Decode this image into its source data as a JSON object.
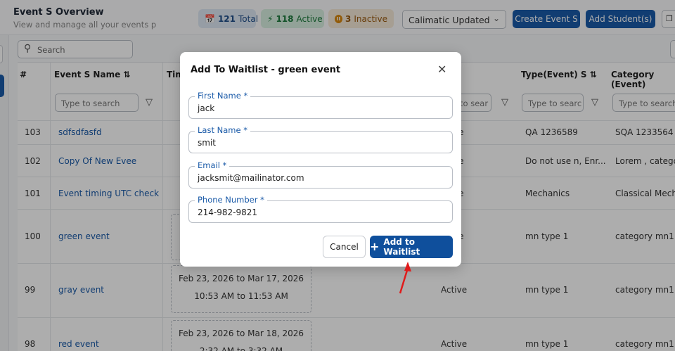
{
  "header": {
    "title": "Event S Overview",
    "subtitle": "View and manage all your events p",
    "stats": {
      "total_count": "121",
      "total_label": "Total",
      "active_count": "118",
      "active_label": "Active",
      "inactive_count": "3",
      "inactive_label": "Inactive"
    },
    "select_value": "Calimatic Updated",
    "create_button": "Create Event S",
    "add_students_button": "Add Student(s)"
  },
  "search": {
    "placeholder": "Search"
  },
  "table": {
    "headers": {
      "number": "#",
      "name": "Event S Name",
      "time": "Tim",
      "type": "Type(Event) S",
      "category": "Category (Event)"
    },
    "filter_placeholder": "Type to search",
    "filter_placeholder_mid": "to sear",
    "filter_placeholder_type": "Type to searc",
    "rows": [
      {
        "id": "103",
        "name": "sdfsdfasfd",
        "status": "ve",
        "type": "QA 1236589",
        "category": "SQA 1233564"
      },
      {
        "id": "102",
        "name": "Copy Of New Evee",
        "status": "ve",
        "type": "Do not use n, Enr...",
        "category": "Lorem , categor"
      },
      {
        "id": "101",
        "name": "Event timing UTC check",
        "status": "ve",
        "type": "Mechanics",
        "category": "Classical Mecha"
      },
      {
        "id": "100",
        "name": "green event",
        "status": "ve",
        "type": "mn type 1",
        "category": "category mn1"
      },
      {
        "id": "99",
        "name": "gray event",
        "status": "Active",
        "type": "mn type 1",
        "category": "category mn1",
        "date": "Feb 23, 2026 to Mar 17, 2026",
        "time": "10:53 AM to 11:53 AM"
      },
      {
        "id": "98",
        "name": "red event",
        "status": "Active",
        "type": "mn type 1",
        "category": "category mn1",
        "date": "Feb 23, 2026 to Mar 18, 2026",
        "time": "2:32 AM to 3:32 AM"
      }
    ]
  },
  "modal": {
    "title": "Add To Waitlist - green event",
    "fields": [
      {
        "label": "First Name *",
        "value": "jack"
      },
      {
        "label": "Last Name *",
        "value": "smit"
      },
      {
        "label": "Email *",
        "value": "jacksmit@mailinator.com"
      },
      {
        "label": "Phone Number *",
        "value": "214-982-9821"
      }
    ],
    "cancel_button": "Cancel",
    "add_button": "Add to Waitlist"
  },
  "colors": {
    "primary": "#1a5aa8",
    "add_button": "#0f4f9c",
    "annotation_arrow": "#e01b1b"
  }
}
